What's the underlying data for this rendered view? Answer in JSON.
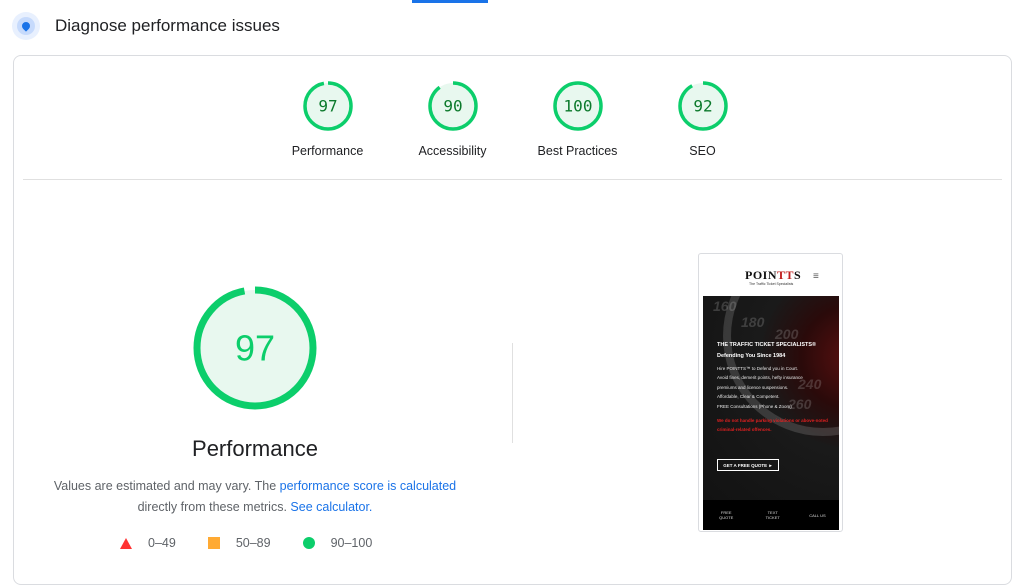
{
  "header": {
    "title": "Diagnose performance issues",
    "icon": "lighthouse-icon"
  },
  "categories": [
    {
      "label": "Performance",
      "score": 97
    },
    {
      "label": "Accessibility",
      "score": 90
    },
    {
      "label": "Best Practices",
      "score": 100
    },
    {
      "label": "SEO",
      "score": 92
    }
  ],
  "main": {
    "score": 97,
    "title": "Performance",
    "desc_prefix": "Values are estimated and may vary. The ",
    "desc_link1": "performance score is calculated",
    "desc_middle": " directly from these metrics. ",
    "desc_link2": "See calculator."
  },
  "legend": [
    {
      "shape": "triangle",
      "range": "0–49",
      "color": "#ff3333"
    },
    {
      "shape": "square",
      "range": "50–89",
      "color": "#ffaa33"
    },
    {
      "shape": "circle",
      "range": "90–100",
      "color": "#0cce6b"
    }
  ],
  "colors": {
    "pass": "#0cce6b",
    "pass_bg": "#e8f8ef",
    "pass_text": "#0c7a2c",
    "link": "#1a73e8"
  },
  "screenshot": {
    "logo_a": "POIN",
    "logo_b": "T",
    "logo_c": "T",
    "logo_d": "S",
    "logo_sub": "The Traffic Ticket Specialists",
    "menu": "≡",
    "heading1": "THE TRAFFIC TICKET SPECIALISTS®",
    "heading2": "Defending You Since 1984",
    "lines": [
      "Hire POINTTS™ to Defend you in Court.",
      "Avoid fines, demerit points, hefty insurance",
      "premiums and licence suspensions.",
      "Affordable, Clear & Competent.",
      "FREE Consultations (Phone & Zoom)"
    ],
    "warning": "We do not handle parking violations or above-noted criminal-related offences.",
    "cta": "GET A FREE QUOTE ►",
    "footer": [
      "FREE QUOTE",
      "TEXT TICKET",
      "CALL US"
    ],
    "dial_numbers": [
      "160",
      "180",
      "200",
      "240",
      "260"
    ]
  }
}
